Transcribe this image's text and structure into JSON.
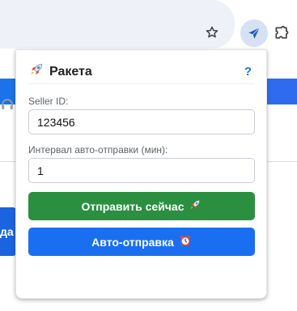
{
  "browser": {
    "toolbar_icons": [
      "star-icon",
      "rocket-extension-icon",
      "puzzle-icon"
    ]
  },
  "background_page": {
    "button_fragment": "да",
    "icons": [
      "headset-icon"
    ]
  },
  "popup": {
    "title": "Ракета",
    "title_icon": "rocket-emoji",
    "help": "?",
    "seller_id": {
      "label": "Seller ID:",
      "value": "123456"
    },
    "interval": {
      "label": "Интервал авто-отправки (мин):",
      "value": "1"
    },
    "send_now": {
      "label": "Отправить сейчас",
      "icon": "rocket-emoji"
    },
    "auto_send": {
      "label": "Авто-отправка",
      "icon": "alarm-clock-emoji"
    }
  },
  "colors": {
    "send_button": "#2a9040",
    "auto_button": "#1a6ff0",
    "help": "#1a73e8"
  }
}
